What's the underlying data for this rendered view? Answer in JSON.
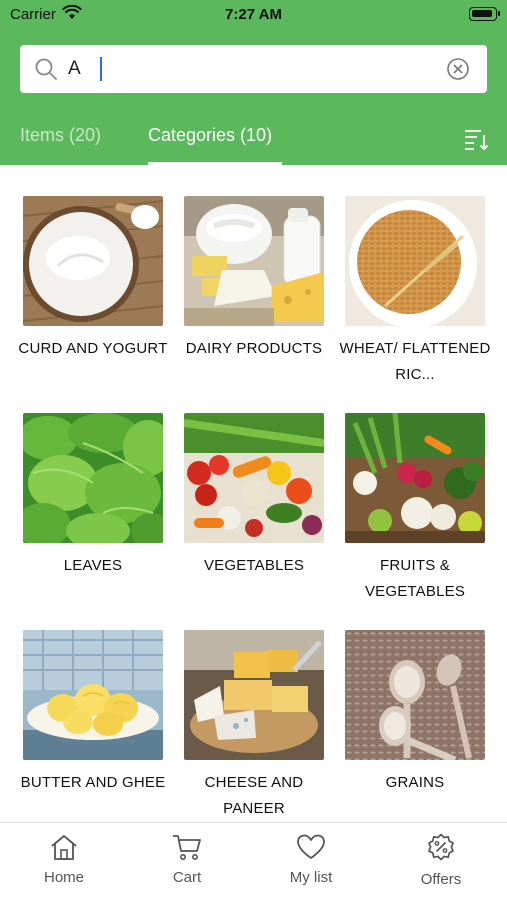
{
  "status_bar": {
    "carrier": "Carrier",
    "time": "7:27 AM"
  },
  "search": {
    "value": "A",
    "placeholder": ""
  },
  "tabs": [
    {
      "label": "Items (20)",
      "active": false
    },
    {
      "label": "Categories (10)",
      "active": true
    }
  ],
  "categories": [
    {
      "label": "CURD AND YOGURT",
      "image": "curd-yogurt"
    },
    {
      "label": "DAIRY PRODUCTS",
      "image": "dairy"
    },
    {
      "label": "WHEAT/ FLATTENED RIC...",
      "image": "wheat"
    },
    {
      "label": "LEAVES",
      "image": "leaves"
    },
    {
      "label": "VEGETABLES",
      "image": "vegetables"
    },
    {
      "label": "FRUITS & VEGETABLES",
      "image": "fruits-vegetables"
    },
    {
      "label": "BUTTER AND GHEE",
      "image": "butter"
    },
    {
      "label": "CHEESE AND PANEER",
      "image": "cheese"
    },
    {
      "label": "GRAINS",
      "image": "grains"
    }
  ],
  "bottom_nav": [
    {
      "label": "Home",
      "icon": "home-icon"
    },
    {
      "label": "Cart",
      "icon": "cart-icon"
    },
    {
      "label": "My list",
      "icon": "heart-icon"
    },
    {
      "label": "Offers",
      "icon": "offers-icon"
    }
  ],
  "colors": {
    "header": "#5cb85c",
    "tab_inactive": "#cfe9cf",
    "text": "#111111"
  }
}
